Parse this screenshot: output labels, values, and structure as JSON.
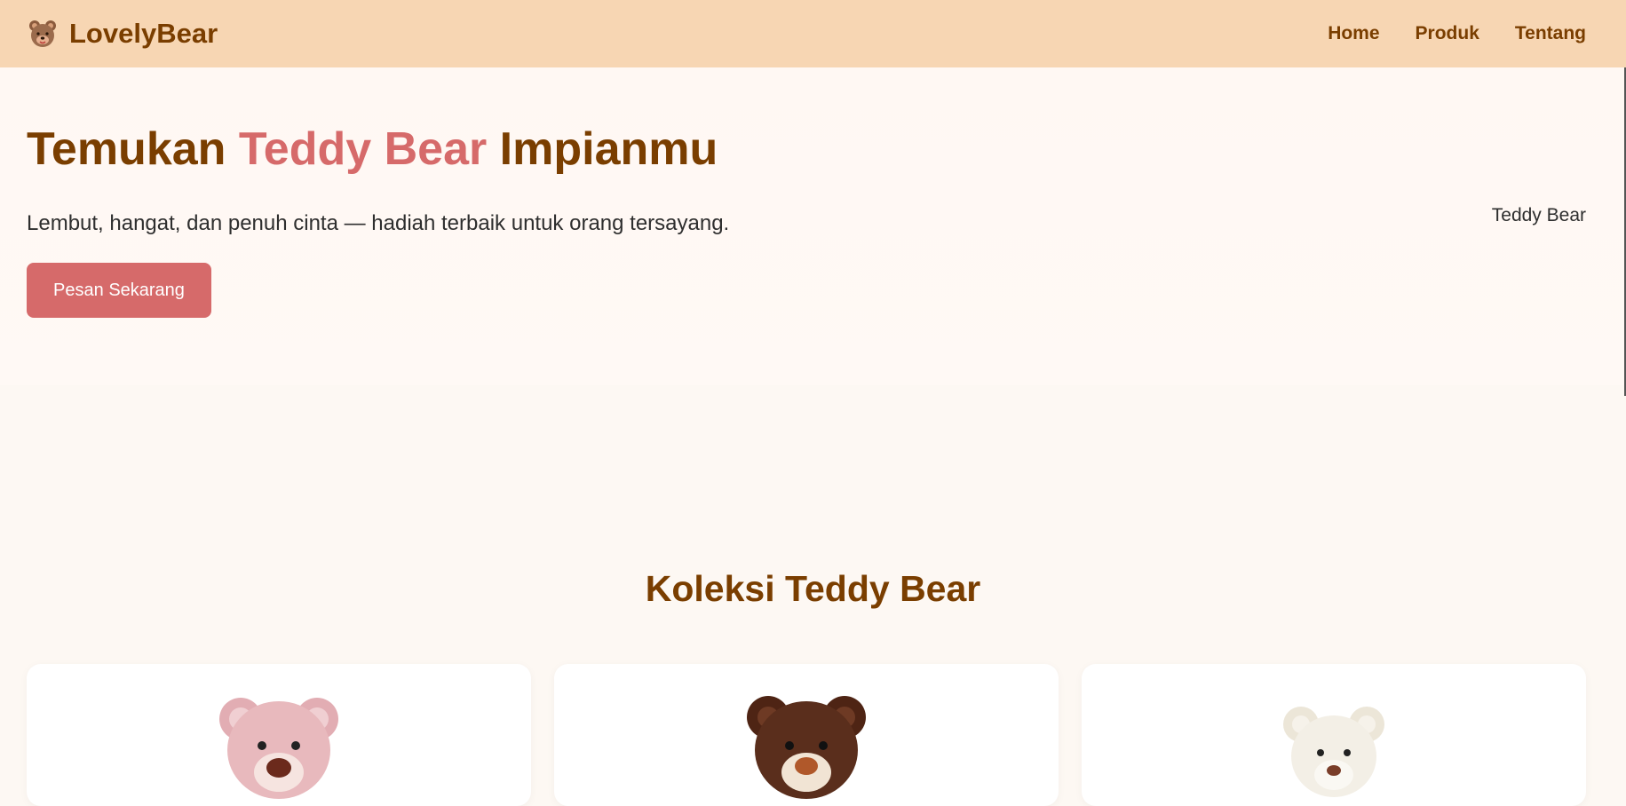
{
  "brand": {
    "name": "LovelyBear",
    "icon": "bear-face-icon"
  },
  "nav": {
    "items": [
      {
        "label": "Home"
      },
      {
        "label": "Produk"
      },
      {
        "label": "Tentang"
      }
    ]
  },
  "hero": {
    "title_part1": "Temukan ",
    "title_accent": "Teddy Bear",
    "title_part2": " Impianmu",
    "subtitle": "Lembut, hangat, dan penuh cinta — hadiah terbaik untuk orang tersayang.",
    "cta_label": "Pesan Sekarang",
    "image_alt": "Teddy Bear"
  },
  "collection": {
    "title": "Koleksi Teddy Bear",
    "cards": [
      {
        "bear_color": "pink",
        "color_hex": "#e8b9bd"
      },
      {
        "bear_color": "brown",
        "color_hex": "#5a2e1c"
      },
      {
        "bear_color": "white",
        "color_hex": "#f3efe6"
      }
    ]
  },
  "colors": {
    "header_bg": "#f7d6b3",
    "brand_text": "#7a3e00",
    "accent": "#d66a6a",
    "page_bg": "#fdf8f3"
  }
}
